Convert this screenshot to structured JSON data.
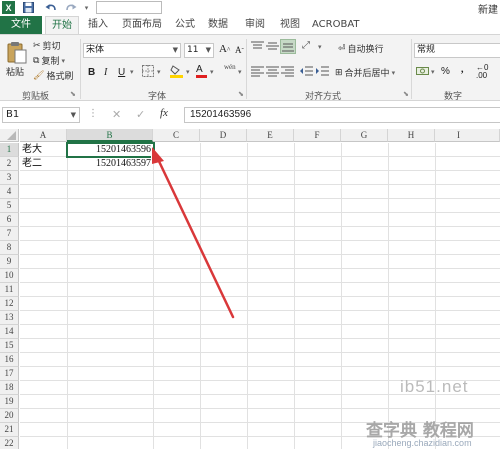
{
  "titlebar": {
    "right_text": "新建",
    "app_logo": "X"
  },
  "tabs": {
    "file": "文件",
    "items": [
      "开始",
      "插入",
      "页面布局",
      "公式",
      "数据",
      "审阅",
      "视图",
      "ACROBAT"
    ]
  },
  "ribbon": {
    "clipboard": {
      "paste": "粘贴",
      "cut": "剪切",
      "copy": "复制",
      "copy_arrow": "▾",
      "format_painter": "格式刷",
      "label": "剪贴板"
    },
    "font": {
      "name": "宋体",
      "size": "11",
      "grow": "A",
      "shrink": "A",
      "bold": "B",
      "italic": "I",
      "underline": "U",
      "color_letter": "A",
      "phonetic": "wén",
      "label": "字体"
    },
    "alignment": {
      "wrap": "自动换行",
      "merge": "合并后居中",
      "label": "对齐方式"
    },
    "number": {
      "format": "常规",
      "percent": "%",
      "comma": ",",
      "label": "数字"
    }
  },
  "formula_bar": {
    "namebox": "B1",
    "more": "⋮",
    "cancel": "✕",
    "enter": "✓",
    "fx": "fx",
    "value": "15201463596"
  },
  "sheet": {
    "columns": [
      "A",
      "B",
      "C",
      "D",
      "E",
      "F",
      "G",
      "H",
      "I"
    ],
    "rows": [
      "1",
      "2",
      "3",
      "4",
      "5",
      "6",
      "7",
      "8",
      "9",
      "10",
      "11",
      "12",
      "13",
      "14",
      "15",
      "16",
      "17",
      "18",
      "19",
      "20",
      "21",
      "22"
    ],
    "cells": {
      "A1": "老大",
      "B1": "15201463596",
      "A2": "老二",
      "B2": "15201463597"
    }
  },
  "watermark": {
    "line1": "ib51.net",
    "line2": "jiaocheng.chazidian.com",
    "line3": "查字典 教程网"
  },
  "colors": {
    "accent": "#217346",
    "annotation_arrow": "#d9383a"
  }
}
